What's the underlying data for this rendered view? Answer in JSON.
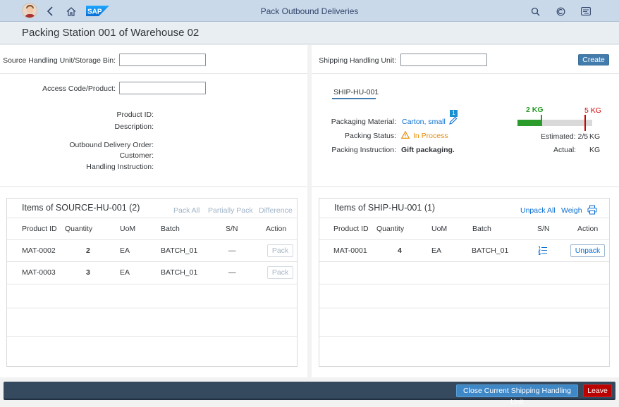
{
  "shell": {
    "title": "Pack Outbound Deliveries",
    "logo_text": "SAP"
  },
  "page": {
    "title": "Packing Station 001 of Warehouse 02"
  },
  "source": {
    "hu_label": "Source Handling Unit/Storage Bin:",
    "hu_value": "",
    "access_label": "Access Code/Product:",
    "access_value": "",
    "product_id_label": "Product ID:",
    "description_label": "Description:",
    "delivery_order_label": "Outbound Delivery Order:",
    "customer_label": "Customer:",
    "handling_instruction_label": "Handling Instruction:"
  },
  "shipping": {
    "hu_label": "Shipping Handling Unit:",
    "hu_value": "",
    "create_label": "Create",
    "tab_label": "SHIP-HU-001",
    "material_label": "Packaging Material:",
    "material_value": "Carton, small",
    "material_badge": "1",
    "status_label": "Packing Status:",
    "status_value": "In Process",
    "instruction_label": "Packing Instruction:",
    "instruction_value": "Gift packaging.",
    "gauge": {
      "current_label": "2 KG",
      "max_label": "5 KG",
      "fill_fraction": 0.4,
      "estimated_label": "Estimated: 2/5",
      "estimated_unit": "KG",
      "actual_label": "Actual:",
      "actual_unit": "KG"
    }
  },
  "source_items": {
    "title": "Items of SOURCE-HU-001 (2)",
    "actions": {
      "pack_all": "Pack All",
      "partially_pack": "Partially Pack",
      "difference": "Difference"
    },
    "columns": [
      "Product ID",
      "Quantity",
      "UoM",
      "Batch",
      "S/N",
      "Action"
    ],
    "rows": [
      {
        "product_id": "MAT-0002",
        "quantity": "2",
        "uom": "EA",
        "batch": "BATCH_01",
        "sn": "—",
        "action": "Pack"
      },
      {
        "product_id": "MAT-0003",
        "quantity": "3",
        "uom": "EA",
        "batch": "BATCH_01",
        "sn": "—",
        "action": "Pack"
      }
    ]
  },
  "ship_items": {
    "title": "Items of SHIP-HU-001 (1)",
    "actions": {
      "unpack_all": "Unpack All",
      "weigh": "Weigh"
    },
    "columns": [
      "Product ID",
      "Quantity",
      "UoM",
      "Batch",
      "S/N",
      "Action"
    ],
    "rows": [
      {
        "product_id": "MAT-0001",
        "quantity": "4",
        "uom": "EA",
        "batch": "BATCH_01",
        "action": "Unpack"
      }
    ]
  },
  "footer": {
    "close_label": "Close Current Shipping Handling Unit",
    "leave_label": "Leave"
  },
  "colors": {
    "shell_bg": "#c9d9ea",
    "accent": "#427cac",
    "link": "#0a6ed1",
    "warning": "#e78c07",
    "gauge_fill": "#2b9c2b",
    "gauge_max": "#d00000",
    "leave": "#bb0000",
    "footer_bg": "#354a5f"
  },
  "icons": [
    "user-avatar",
    "back-icon",
    "home-icon",
    "search-icon",
    "copilot-icon",
    "notifications-icon",
    "edit-icon",
    "warning-icon",
    "print-icon",
    "serial-numbers-icon"
  ]
}
